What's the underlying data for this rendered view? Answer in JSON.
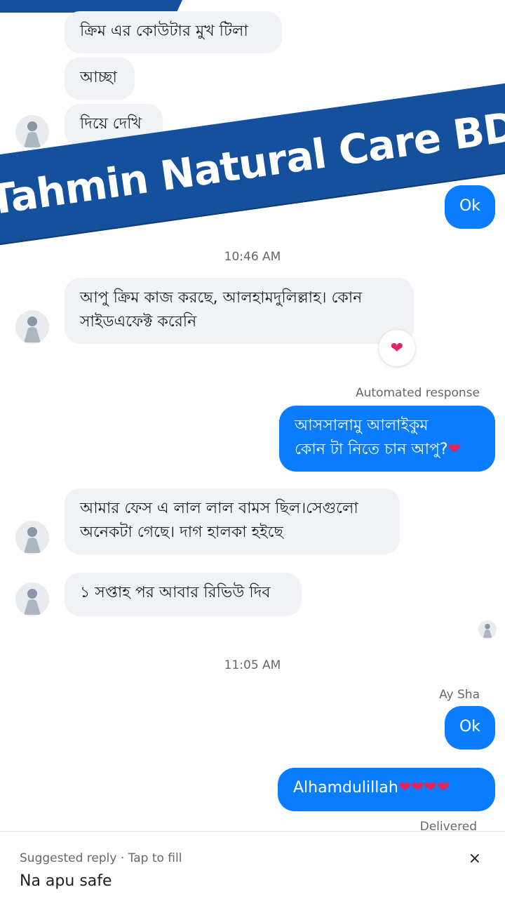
{
  "brand": {
    "banner_text": "Tahmin Natural Care BD",
    "banner_color": "#14509c"
  },
  "colors": {
    "outgoing": "#0a7cff",
    "incoming": "#f0f2f5",
    "heart": "#e0245e"
  },
  "messages": {
    "m1": "ক্রিম এর কোউটার মুখ টিলা",
    "m2": "আচ্ছা",
    "m3": "দিয়ে দেখি",
    "ok1": "Ok",
    "time1": "10:46 AM",
    "m4_line1": "আপু ক্রিম কাজ করছে, আলহামদুলিল্লাহ। কোন",
    "m4_line2": "সাইডএফেক্ট করেনি",
    "reaction1": "❤",
    "automated_label": "Automated response",
    "m5_line1": "আসসালামু আলাইকুম",
    "m5_line2": "কোন টা নিতে চান আপু?",
    "m5_heart": "❤",
    "m6_line1": "আমার ফেস এ লাল লাল বামস ছিল।সেগুলো",
    "m6_line2": "অনেকটা  গেছে। দাগ হালকা হইছে",
    "m7": "১ সপ্তাহ পর আবার রিভিউ দিব",
    "time2": "11:05 AM",
    "sender_name": "Ay Sha",
    "ok2": "Ok",
    "m8_text": "Alhamdulillah",
    "m8_hearts": "❤❤❤❤",
    "delivered": "Delivered"
  },
  "suggested": {
    "label": "Suggested reply · Tap to fill",
    "text": "Na apu safe",
    "close": "×"
  },
  "icons": {
    "avatar": "user-avatar-icon",
    "close": "close-icon",
    "heart": "heart-icon"
  }
}
